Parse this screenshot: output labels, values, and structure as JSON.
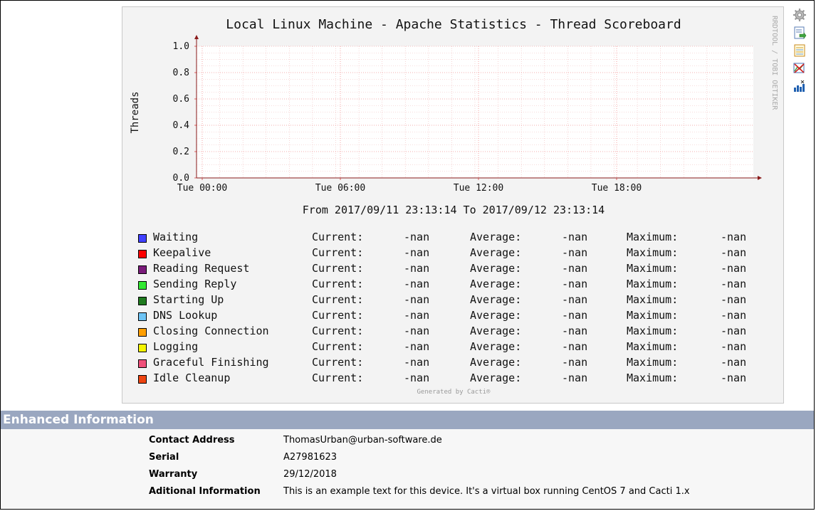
{
  "graph": {
    "title": "Local Linux Machine - Apache Statistics - Thread Scoreboard",
    "ylabel": "Threads",
    "watermark": "RRDTOOL / TOBI OETIKER",
    "date_range": "From 2017/09/11 23:13:14 To 2017/09/12 23:13:14",
    "generated_by": "Generated by Cacti®"
  },
  "chart_data": {
    "type": "area",
    "title": "Local Linux Machine - Apache Statistics - Thread Scoreboard",
    "xlabel": "",
    "ylabel": "Threads",
    "ylim": [
      0,
      1.0
    ],
    "y_ticks": [
      "0.0",
      "0.2",
      "0.4",
      "0.6",
      "0.8",
      "1.0"
    ],
    "y_tick_values": [
      0,
      0.2,
      0.4,
      0.6,
      0.8,
      1.0
    ],
    "x_ticks": [
      "Tue 00:00",
      "Tue 06:00",
      "Tue 12:00",
      "Tue 18:00"
    ],
    "grid": true,
    "series": []
  },
  "legend": {
    "current_label": "Current:",
    "average_label": "Average:",
    "maximum_label": "Maximum:",
    "items": [
      {
        "name": "Waiting",
        "color": "#4040ff",
        "current": "-nan",
        "average": "-nan",
        "maximum": "-nan"
      },
      {
        "name": "Keepalive",
        "color": "#ff0000",
        "current": "-nan",
        "average": "-nan",
        "maximum": "-nan"
      },
      {
        "name": "Reading Request",
        "color": "#7a1b7a",
        "current": "-nan",
        "average": "-nan",
        "maximum": "-nan"
      },
      {
        "name": "Sending Reply",
        "color": "#32e832",
        "current": "-nan",
        "average": "-nan",
        "maximum": "-nan"
      },
      {
        "name": "Starting Up",
        "color": "#1f7a1f",
        "current": "-nan",
        "average": "-nan",
        "maximum": "-nan"
      },
      {
        "name": "DNS Lookup",
        "color": "#6ec4f5",
        "current": "-nan",
        "average": "-nan",
        "maximum": "-nan"
      },
      {
        "name": "Closing Connection",
        "color": "#ff9f00",
        "current": "-nan",
        "average": "-nan",
        "maximum": "-nan"
      },
      {
        "name": "Logging",
        "color": "#f5f500",
        "current": "-nan",
        "average": "-nan",
        "maximum": "-nan"
      },
      {
        "name": "Graceful Finishing",
        "color": "#f0507a",
        "current": "-nan",
        "average": "-nan",
        "maximum": "-nan"
      },
      {
        "name": "Idle Cleanup",
        "color": "#ee4411",
        "current": "-nan",
        "average": "-nan",
        "maximum": "-nan"
      }
    ]
  },
  "side_icons": [
    "gear-icon",
    "export-icon",
    "csv-icon",
    "zoom-icon",
    "graph-properties-icon"
  ],
  "enhanced": {
    "header": "Enhanced Information",
    "rows": [
      {
        "label": "Contact Address",
        "value": "ThomasUrban@urban-software.de"
      },
      {
        "label": "Serial",
        "value": "A27981623"
      },
      {
        "label": "Warranty",
        "value": "29/12/2018"
      },
      {
        "label": "Aditional Information",
        "value": "This is an example text for this device. It's a virtual box running CentOS 7 and Cacti 1.x"
      }
    ]
  }
}
